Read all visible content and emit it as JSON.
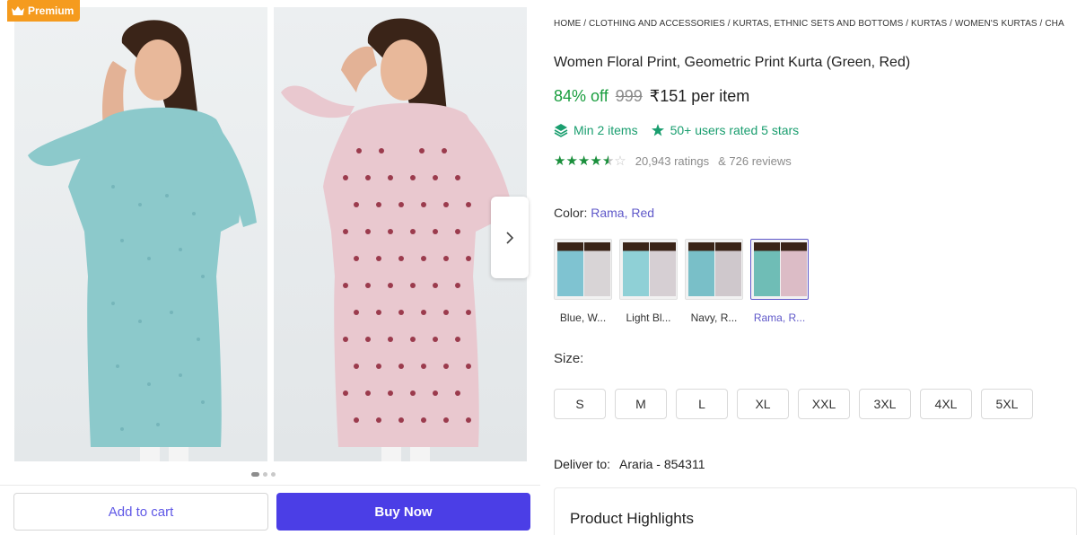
{
  "badge": {
    "label": "Premium",
    "icon": "crown-icon"
  },
  "gallery": {
    "dots": 3,
    "active_dot": 0
  },
  "actions": {
    "add_to_cart": "Add to cart",
    "buy_now": "Buy Now"
  },
  "breadcrumb": "HOME / CLOTHING AND ACCESSORIES / KURTAS, ETHNIC SETS AND BOTTOMS / KURTAS / WOMEN'S KURTAS / CHA",
  "product": {
    "title": "Women Floral Print, Geometric Print Kurta (Green, Red)",
    "discount": "84% off",
    "mrp": "999",
    "price": "₹151 per item"
  },
  "offers": {
    "min_items": "Min 2 items",
    "rated": "50+ users rated 5 stars"
  },
  "rating": {
    "stars": 4.5,
    "ratings": "20,943 ratings",
    "reviews": "& 726 reviews"
  },
  "color": {
    "label": "Color:",
    "selected": "Rama, Red",
    "options": [
      {
        "name": "Blue, W...",
        "left": "#7fc3d1",
        "right": "#d8d4d6"
      },
      {
        "name": "Light Bl...",
        "left": "#8fd0d6",
        "right": "#d6cfd3"
      },
      {
        "name": "Navy, R...",
        "left": "#79bfc8",
        "right": "#cfc8cc"
      },
      {
        "name": "Rama, R...",
        "left": "#6fbdb6",
        "right": "#dcbcc6"
      }
    ],
    "active_index": 3
  },
  "size": {
    "label": "Size:",
    "options": [
      "S",
      "M",
      "L",
      "XL",
      "XXL",
      "3XL",
      "4XL",
      "5XL"
    ]
  },
  "delivery": {
    "label": "Deliver to:",
    "location": "Araria - 854311"
  },
  "highlights": {
    "title": "Product Highlights"
  },
  "colors": {
    "accent": "#4b3ee6",
    "green": "#1a9e3f",
    "teal": "#1a9e6f",
    "premium": "#f59b1e"
  }
}
